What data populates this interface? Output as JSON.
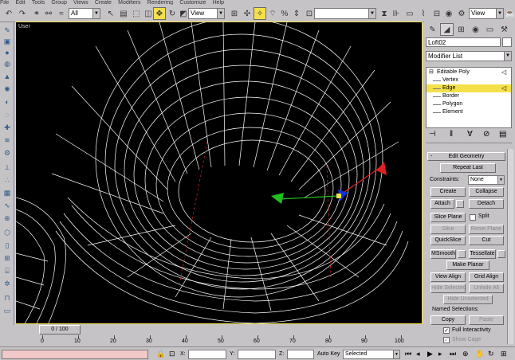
{
  "menu": [
    "File",
    "Edit",
    "Tools",
    "Group",
    "Views",
    "Create",
    "Modifiers",
    "Rendering",
    "Customize",
    "Help"
  ],
  "toolbar": {
    "filter_value": "All",
    "refcoord_value": "View",
    "named_sel_value": "",
    "view_value": "View"
  },
  "viewport": {
    "label": "User"
  },
  "command_panel": {
    "object_name": "Loft02",
    "modifier_list_label": "Modifier List",
    "stack": [
      {
        "label": "Editable Poly",
        "level": 0,
        "selected": false
      },
      {
        "label": "Vertex",
        "level": 1,
        "selected": false
      },
      {
        "label": "Edge",
        "level": 1,
        "selected": true
      },
      {
        "label": "Border",
        "level": 1,
        "selected": false
      },
      {
        "label": "Polygon",
        "level": 1,
        "selected": false
      },
      {
        "label": "Element",
        "level": 1,
        "selected": false
      }
    ],
    "rollout_title": "Edit Geometry",
    "repeat_last": "Repeat Last",
    "constraints_label": "Constraints:",
    "constraints_value": "None",
    "create": "Create",
    "collapse": "Collapse",
    "attach": "Attach",
    "detach": "Detach",
    "slice_plane": "Slice Plane",
    "split": "Split",
    "slice": "Slice",
    "reset_plane": "Reset Plane",
    "quickslice": "QuickSlice",
    "cut": "Cut",
    "msmooth": "MSmooth",
    "tessellate": "Tessellate",
    "make_planar": "Make Planar",
    "view_align": "View Align",
    "grid_align": "Grid Align",
    "hide_selected": "Hide Selected",
    "unhide_all": "Unhide All",
    "hide_unselected": "Hide Unselected",
    "named_selections_label": "Named Selections:",
    "copy": "Copy",
    "paste": "Paste",
    "full_interactivity": "Full Interactivity",
    "show_cage": "Show Cage"
  },
  "timeline": {
    "slider_label": "0 / 100",
    "ticks": [
      "0",
      "10",
      "20",
      "30",
      "40",
      "50",
      "60",
      "70",
      "80",
      "90",
      "100"
    ]
  },
  "status": {
    "x_label": "X:",
    "y_label": "Y:",
    "z_label": "Z:",
    "auto_key": "Auto Key",
    "selected_value": "Selected"
  },
  "icons": [
    "undo-icon",
    "redo-icon",
    "select-icon",
    "move-icon",
    "rotate-icon",
    "scale-icon",
    "snap-icon",
    "mirror-icon",
    "align-icon",
    "render-icon",
    "plus-icon",
    "minus-icon",
    "create-tab-icon",
    "modify-tab-icon",
    "hierarchy-tab-icon",
    "motion-tab-icon",
    "display-tab-icon",
    "utilities-tab-icon",
    "pin-icon",
    "play-icon",
    "key-icon"
  ],
  "colors": {
    "viewport_bg": "#000000",
    "wire": "#ffffff",
    "active_highlight": "#f4e04a",
    "panel_bg": "#c6c3c6",
    "gizmo_x": "#e02020",
    "gizmo_y": "#20c020",
    "gizmo_z": "#1030e0"
  }
}
